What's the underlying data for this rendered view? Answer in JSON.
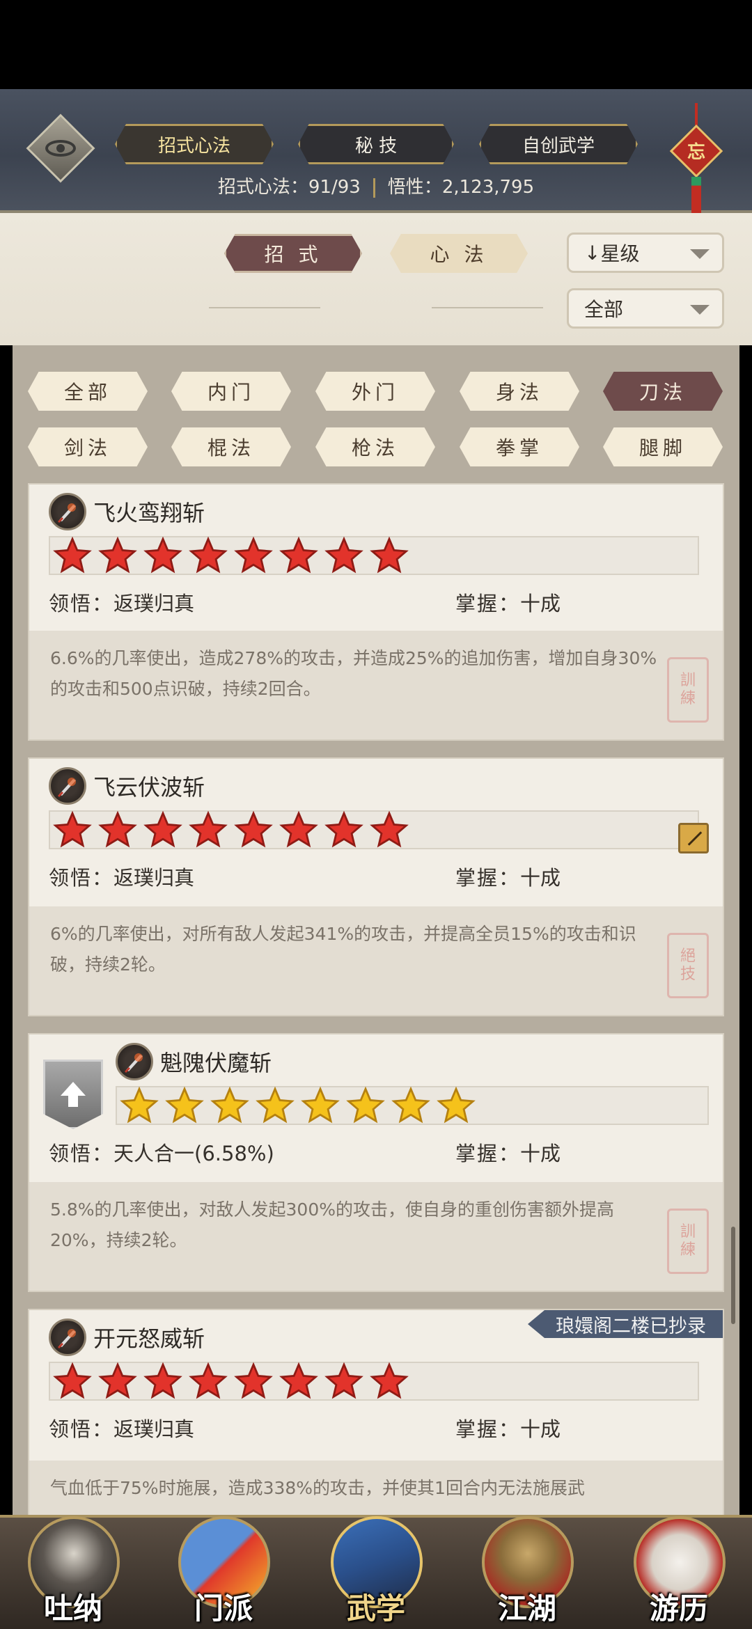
{
  "header": {
    "tabs": [
      {
        "label": "招式心法",
        "active": true
      },
      {
        "label": "秘 技",
        "active": false
      },
      {
        "label": "自创武学",
        "active": false
      }
    ],
    "talisman_char": "忘",
    "stats": {
      "moves_label": "招式心法：",
      "moves_value": "91/93",
      "insight_label": "悟性：",
      "insight_value": "2,123,795"
    }
  },
  "filters": {
    "primary": [
      "招 式",
      "心 法"
    ],
    "primary_active": "招 式",
    "sort": {
      "arrow": "↓",
      "label": "星级"
    },
    "scope": "全部",
    "categories": [
      "全部",
      "内门",
      "外门",
      "身法",
      "刀法",
      "剑法",
      "棍法",
      "枪法",
      "拳掌",
      "腿脚"
    ],
    "active_category": "刀法"
  },
  "skills": [
    {
      "name": "飞火鸾翔斩",
      "stars": 8,
      "star_color": "red",
      "comprehension_label": "领悟：",
      "comprehension": "返璞归真",
      "mastery_label": "掌握：",
      "mastery": "十成",
      "description": "6.6%的几率使出，造成278%的攻击，并造成25%的追加伤害，增加自身30%的攻击和500点识破，持续2回合。"
    },
    {
      "name": "飞云伏波斩",
      "stars": 8,
      "star_color": "red",
      "comprehension_label": "领悟：",
      "comprehension": "返璞归真",
      "mastery_label": "掌握：",
      "mastery": "十成",
      "description": "6%的几率使出，对所有敌人发起341%的攻击，并提高全员15%的攻击和识破，持续2轮。"
    },
    {
      "name": "魁隗伏魔斩",
      "stars": 8,
      "star_color": "gold",
      "comprehension_label": "领悟：",
      "comprehension": "天人合一(6.58%)",
      "mastery_label": "掌握：",
      "mastery": "十成",
      "description": "5.8%的几率使出，对敌人发起300%的攻击，使自身的重创伤害额外提高20%，持续2轮。"
    },
    {
      "name": "开元怒威斩",
      "stars": 8,
      "star_color": "red",
      "tag": "琅嬛阁二楼已抄录",
      "comprehension_label": "领悟：",
      "comprehension": "返璞归真",
      "mastery_label": "掌握：",
      "mastery": "十成",
      "description": "气血低于75%时施展，造成338%的攻击，并使其1回合内无法施展武"
    }
  ],
  "bottom_nav": [
    {
      "label": "吐纳",
      "icon": "meditation-icon"
    },
    {
      "label": "门派",
      "icon": "sect-icon"
    },
    {
      "label": "武学",
      "icon": "martial-arts-book-icon",
      "active": true
    },
    {
      "label": "江湖",
      "icon": "straw-hat-icon"
    },
    {
      "label": "游历",
      "icon": "horse-icon"
    }
  ],
  "colors": {
    "header_bg": "#3c4350",
    "active_pill": "#6e4b4b",
    "star_red": "#e2332b",
    "star_gold": "#f5c21b",
    "tag_bg": "#4c5a72"
  }
}
